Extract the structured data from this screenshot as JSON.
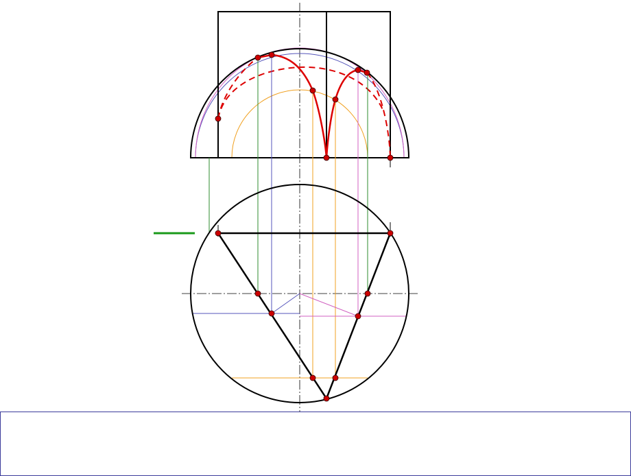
{
  "colors": {
    "background": "#ffffff",
    "outline": "#000000",
    "section_curve": "#dd0000",
    "point_fill": "#cc0000",
    "construction_green": "#2e8b2e",
    "construction_blue": "#5555bb",
    "construction_magenta": "#d060c0",
    "construction_orange": "#f0a020",
    "legend_swatch": "#1a9a1a",
    "panel_border": "#3a3a9a"
  },
  "legend": {
    "swatch_color_name": "green"
  },
  "drawing": {
    "views": [
      "front-view-hemisphere",
      "top-view-circle"
    ],
    "cutting_prism": "triangular",
    "section_curve_style": [
      "solid-visible",
      "dashed-hidden"
    ],
    "key_points": 12
  },
  "bottom_panel": {
    "text": ""
  }
}
